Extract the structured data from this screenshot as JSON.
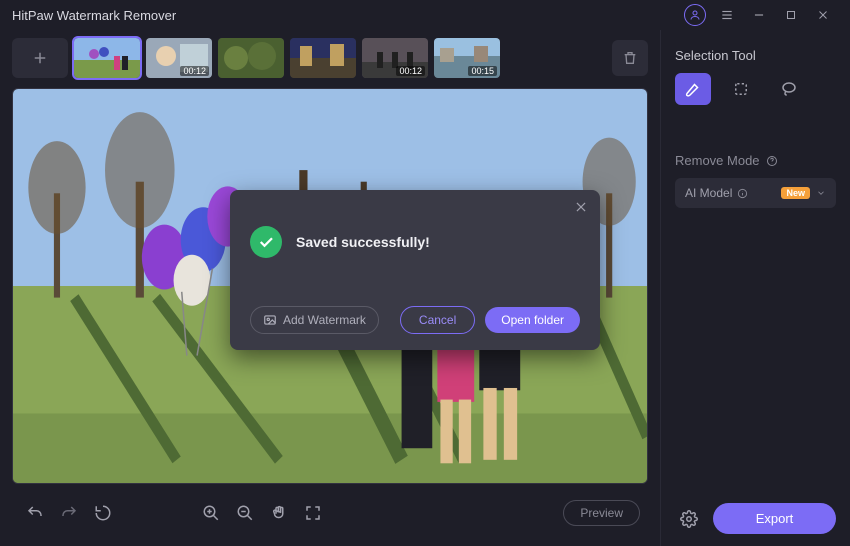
{
  "titlebar": {
    "title": "HitPaw Watermark Remover"
  },
  "thumbnails": [
    {
      "duration": ""
    },
    {
      "duration": "00:12"
    },
    {
      "duration": ""
    },
    {
      "duration": ""
    },
    {
      "duration": "00:12"
    },
    {
      "duration": "00:15"
    }
  ],
  "modal": {
    "message": "Saved successfully!",
    "add_watermark": "Add Watermark",
    "cancel": "Cancel",
    "open_folder": "Open folder"
  },
  "sidebar": {
    "selection_tool_label": "Selection Tool",
    "remove_mode_label": "Remove Mode",
    "mode_option": "AI Model",
    "badge": "New",
    "export": "Export"
  },
  "toolbar": {
    "preview": "Preview"
  }
}
